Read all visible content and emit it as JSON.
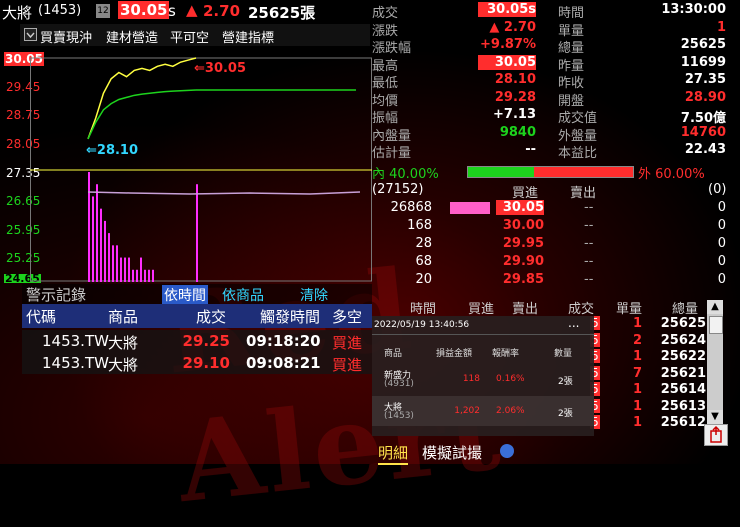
{
  "header": {
    "name": "大將",
    "code": "(1453)",
    "badge": "12",
    "price": "30.05",
    "price_flag": "s",
    "change_arrow": "▲",
    "change": "2.70",
    "volume": "25625張"
  },
  "menu": {
    "checkbox_label": "買賣現沖",
    "items": [
      "建材營造",
      "平可空",
      "營建指標"
    ]
  },
  "chart_data": {
    "type": "line",
    "y_ticks": [
      "30.05",
      "29.45",
      "28.75",
      "28.05",
      "27.35",
      "26.65",
      "25.95",
      "25.25",
      "24.65"
    ],
    "annotations": [
      {
        "text": "30.05",
        "color": "#ff2d2d"
      },
      {
        "text": "28.10",
        "color": "#32d7ff"
      }
    ],
    "ylim": [
      24.65,
      30.05
    ],
    "reference": 27.35,
    "series": [
      {
        "color": "#ffff40",
        "values": [
          28.1,
          28.6,
          29.2,
          29.55,
          29.7,
          29.6,
          29.75,
          29.8,
          29.75,
          29.85,
          29.9,
          29.85,
          29.95,
          30.0,
          30.05
        ]
      },
      {
        "color": "#1dd31d",
        "values": [
          28.1,
          28.5,
          28.8,
          28.95,
          29.05,
          29.1,
          29.15,
          29.18,
          29.2,
          29.22,
          29.24,
          29.25,
          29.26,
          29.27,
          29.28
        ]
      }
    ],
    "volume_bars": [
      9,
      7,
      8,
      6,
      5,
      4,
      3,
      3,
      2,
      2,
      2,
      1,
      1,
      2,
      1,
      1,
      1,
      8
    ]
  },
  "quote": {
    "rows": [
      {
        "l1": "成交",
        "v1": "30.05s",
        "c1": "#fff",
        "box1": "#ff2d2d",
        "l2": "時間",
        "v2": "13:30:00",
        "c2": "#fff"
      },
      {
        "l1": "漲跌",
        "v1": "▲ 2.70",
        "c1": "#ff2d2d",
        "l2": "單量",
        "v2": "1",
        "c2": "#ff2d2d"
      },
      {
        "l1": "漲跌幅",
        "v1": "+9.87%",
        "c1": "#ff2d2d",
        "l2": "總量",
        "v2": "25625",
        "c2": "#fff"
      },
      {
        "l1": "最高",
        "v1": "30.05",
        "c1": "#fff",
        "box1": "#ff2d2d",
        "l2": "昨量",
        "v2": "11699",
        "c2": "#fff"
      },
      {
        "l1": "最低",
        "v1": "28.10",
        "c1": "#ff2d2d",
        "l2": "昨收",
        "v2": "27.35",
        "c2": "#fff"
      },
      {
        "l1": "均價",
        "v1": "29.28",
        "c1": "#ff2d2d",
        "l2": "開盤",
        "v2": "28.90",
        "c2": "#ff2d2d"
      },
      {
        "l1": "振幅",
        "v1": "+7.13",
        "c1": "#fff",
        "l2": "成交值",
        "v2": "7.50億",
        "c2": "#fff"
      },
      {
        "l1": "內盤量",
        "v1": "9840",
        "c1": "#1dd31d",
        "l2": "外盤量",
        "v2": "14760",
        "c2": "#ff2d2d"
      },
      {
        "l1": "估計量",
        "v1": "--",
        "c1": "#fff",
        "l2": "本益比",
        "v2": "22.43",
        "c2": "#fff"
      }
    ],
    "inner_label": "內 40.00%",
    "outer_label": "外 60.00%",
    "inner_pct": 40,
    "book_header": {
      "left": "(27152)",
      "bid": "買進",
      "ask": "賣出",
      "right": "(0)"
    },
    "book": [
      {
        "qty": "26868",
        "bid": "30.05",
        "ask": "--",
        "askqty": "0",
        "bar": 1.0,
        "hl": true
      },
      {
        "qty": "168",
        "bid": "30.00",
        "ask": "--",
        "askqty": "0"
      },
      {
        "qty": "28",
        "bid": "29.95",
        "ask": "--",
        "askqty": "0"
      },
      {
        "qty": "68",
        "bid": "29.90",
        "ask": "--",
        "askqty": "0"
      },
      {
        "qty": "20",
        "bid": "29.85",
        "ask": "--",
        "askqty": "0"
      }
    ]
  },
  "alert": {
    "title": "警示記錄",
    "tabs": [
      "依時間",
      "依商品",
      "清除"
    ],
    "columns": [
      "代碼",
      "商品",
      "成交",
      "觸發時間",
      "多空"
    ],
    "rows": [
      {
        "code": "1453.TW",
        "name": "大將",
        "price": "29.25",
        "time": "09:18:20",
        "side": "買進"
      },
      {
        "code": "1453.TW",
        "name": "大將",
        "price": "29.10",
        "time": "09:08:21",
        "side": "買進"
      }
    ]
  },
  "ticks": {
    "columns": [
      "時間",
      "買進",
      "賣出",
      "成交",
      "單量",
      "總量"
    ],
    "rows": [
      {
        "vol": "1",
        "total": "25625"
      },
      {
        "vol": "2",
        "total": "25624"
      },
      {
        "vol": "1",
        "total": "25622"
      },
      {
        "vol": "7",
        "total": "25621"
      },
      {
        "vol": "1",
        "total": "25614"
      },
      {
        "vol": "1",
        "total": "25613"
      },
      {
        "vol": "1",
        "total": "25612"
      }
    ],
    "edge_digit": "5"
  },
  "popup": {
    "date": "2022/05/19 13:40:56",
    "menu_icon": "...",
    "columns": [
      "商品",
      "損益金額",
      "報酬率",
      "數量"
    ],
    "rows": [
      {
        "name": "新盛力",
        "code": "(4931)",
        "pnl": "118",
        "ret": "0.16%",
        "qty": "2張"
      },
      {
        "name": "大將",
        "code": "(1453)",
        "pnl": "1,202",
        "ret": "2.06%",
        "qty": "2張"
      }
    ]
  },
  "bottom_tabs": [
    "明細",
    "模擬試撮"
  ],
  "watermark": "Red Alert"
}
